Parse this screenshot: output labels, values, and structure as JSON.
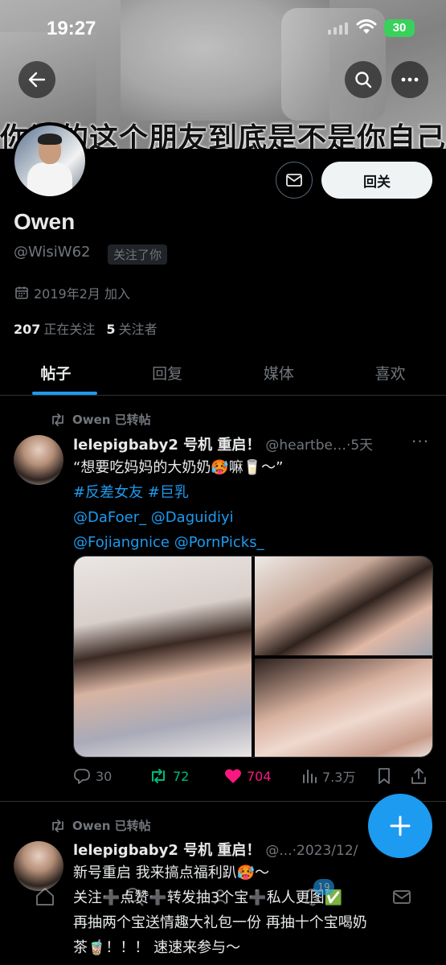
{
  "status_bar": {
    "time": "19:27",
    "battery": "30"
  },
  "header": {
    "banner_caption": "你说的这个朋友到底是不是你自己"
  },
  "profile": {
    "name": "Owen",
    "handle": "@WisiW62",
    "follows_you": "关注了你",
    "joined": "2019年2月 加入",
    "following_count": "207",
    "following_label": "正在关注",
    "followers_count": "5",
    "followers_label": "关注者",
    "follow_back_label": "回关"
  },
  "tabs": [
    {
      "label": "帖子",
      "active": true
    },
    {
      "label": "回复",
      "active": false
    },
    {
      "label": "媒体",
      "active": false
    },
    {
      "label": "喜欢",
      "active": false
    }
  ],
  "tweets": [
    {
      "repost_label": "Owen 已转帖",
      "author": "lelepigbaby2 号机 重启！",
      "meta": "@heartbe…·5天",
      "text_line1": "“想要吃妈妈的大奶奶🥵嘛🥛～”",
      "hashtags": "#反差女友 #巨乳",
      "mentions_line1": "@DaFoer_ @Daguidiyi",
      "mentions_line2": "@Fojiangnice @PornPicks_",
      "replies": "30",
      "reposts": "72",
      "likes": "704",
      "views": "7.3万"
    },
    {
      "repost_label": "Owen 已转帖",
      "author": "lelepigbaby2 号机 重启！",
      "meta": "@...·2023/12/",
      "line1": "新号重启 我来搞点福利趴🥵～",
      "line2": "关注➕点赞➕转发抽3个宝➕私人更图✅",
      "line3": "再抽两个宝送情趣大礼包一份 再抽十个宝喝奶",
      "line4": "茶🧋！！！ 速速来参与～"
    }
  ],
  "notifications_badge": "19",
  "colors": {
    "accent": "#1d9bf0",
    "like": "#f91880",
    "repost": "#00ba7c",
    "background": "#000000"
  }
}
